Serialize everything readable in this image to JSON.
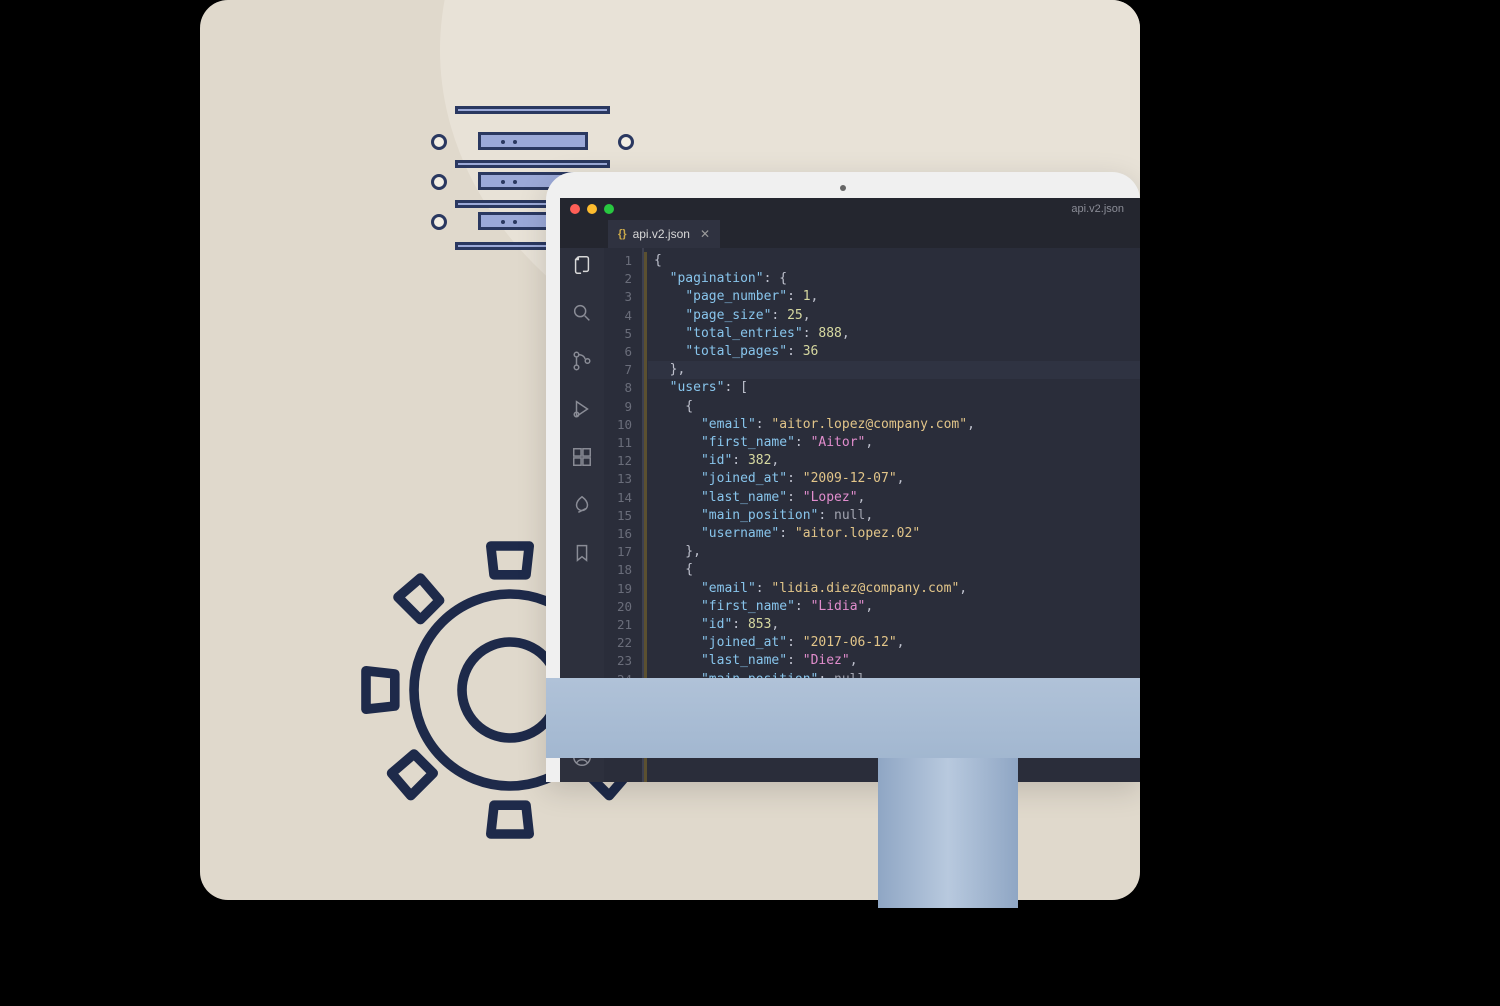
{
  "window": {
    "title": "api.v2.json"
  },
  "tab": {
    "filename": "api.v2.json",
    "badge": "{}"
  },
  "code": {
    "pagination": {
      "page_number": 1,
      "page_size": 25,
      "total_entries": 888,
      "total_pages": 36
    },
    "users": [
      {
        "email": "aitor.lopez@company.com",
        "first_name": "Aitor",
        "id": 382,
        "joined_at": "2009-12-07",
        "last_name": "Lopez",
        "main_position": null,
        "username": "aitor.lopez.02"
      },
      {
        "email": "lidia.diez@company.com",
        "first_name": "Lidia",
        "id": 853,
        "joined_at": "2017-06-12",
        "last_name": "Diez",
        "main_position": null
      }
    ]
  },
  "labels": {
    "pagination": "pagination",
    "page_number": "page_number",
    "page_size": "page_size",
    "total_entries": "total_entries",
    "total_pages": "total_pages",
    "users": "users",
    "email": "email",
    "first_name": "first_name",
    "id": "id",
    "joined_at": "joined_at",
    "last_name": "last_name",
    "main_position": "main_position",
    "username": "username",
    "null": "null"
  }
}
